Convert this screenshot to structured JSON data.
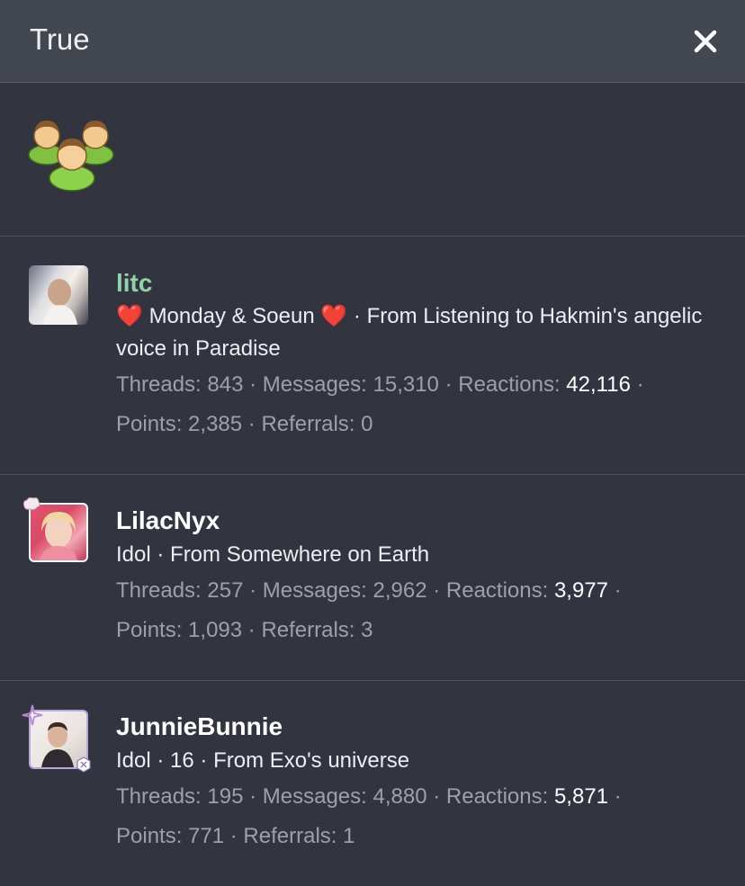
{
  "header": {
    "title": "True"
  },
  "members": [
    {
      "username": "litc",
      "username_color": "#8fd3a8",
      "title_text": "Monday & Soeun",
      "location_sep": " · ",
      "location": "From Listening to Hakmin's angelic voice in Paradise",
      "threads_label": "Threads:",
      "threads": "843",
      "messages_label": "Messages:",
      "messages": "15,310",
      "reactions_label": "Reactions:",
      "reactions": "42,116",
      "points_label": "Points:",
      "points": "2,385",
      "referrals_label": "Referrals:",
      "referrals": "0"
    },
    {
      "username": "LilacNyx",
      "username_color": "#ffffff",
      "title_text": "Idol",
      "location_sep": " · ",
      "location": "From Somewhere on Earth",
      "threads_label": "Threads:",
      "threads": "257",
      "messages_label": "Messages:",
      "messages": "2,962",
      "reactions_label": "Reactions:",
      "reactions": "3,977",
      "points_label": "Points:",
      "points": "1,093",
      "referrals_label": "Referrals:",
      "referrals": "3"
    },
    {
      "username": "JunnieBunnie",
      "username_color": "#ffffff",
      "title_text": "Idol",
      "age": "16",
      "location_sep": " · ",
      "location": "From Exo's universe",
      "threads_label": "Threads:",
      "threads": "195",
      "messages_label": "Messages:",
      "messages": "4,880",
      "reactions_label": "Reactions:",
      "reactions": "5,871",
      "points_label": "Points:",
      "points": "771",
      "referrals_label": "Referrals:",
      "referrals": "1"
    }
  ],
  "separator": " · ",
  "icons": {
    "close": "close-icon",
    "group": "group-members-icon",
    "heart": "heart-icon"
  },
  "colors": {
    "background": "#32353f",
    "header": "#434750",
    "stats_text": "#9ca0aa",
    "heart": "#e0302e",
    "highlight_username": "#8fd3a8"
  }
}
